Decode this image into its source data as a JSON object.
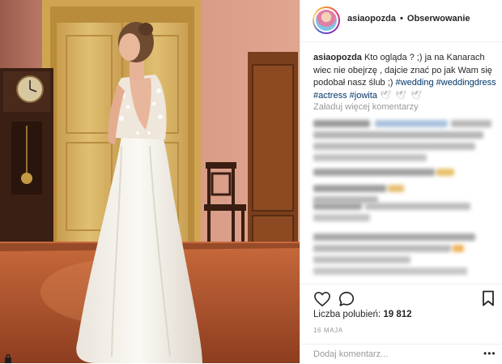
{
  "header": {
    "username": "asiaopozda",
    "separator": "•",
    "follow_label": "Obserwowanie"
  },
  "caption": {
    "username": "asiaopozda",
    "text": "Kto ogląda ? ;) ja na Kanarach wiec nie obejrzę , dajcie znać po jak Wam się podobał nasz ślub ;)",
    "hashtags": [
      "#wedding",
      "#weddingdress",
      "#actress",
      "#jowita"
    ],
    "emoji": "🕊 🕊 🕊"
  },
  "comments": {
    "load_more_label": "Załaduj więcej komentarzy"
  },
  "actions": {
    "like_icon": "heart-icon",
    "comment_icon": "comment-bubble-icon",
    "save_icon": "bookmark-icon"
  },
  "likes": {
    "label": "Liczba polubień:",
    "count": "19 812"
  },
  "date": "16 MAJA",
  "comment_bar": {
    "placeholder": "Dodaj komentarz...",
    "more_label": "•••"
  },
  "colors": {
    "wall": "#d59a86",
    "door": "#d9b566",
    "floor": "#b9582f",
    "hashtag": "#003569",
    "muted": "#999999"
  }
}
